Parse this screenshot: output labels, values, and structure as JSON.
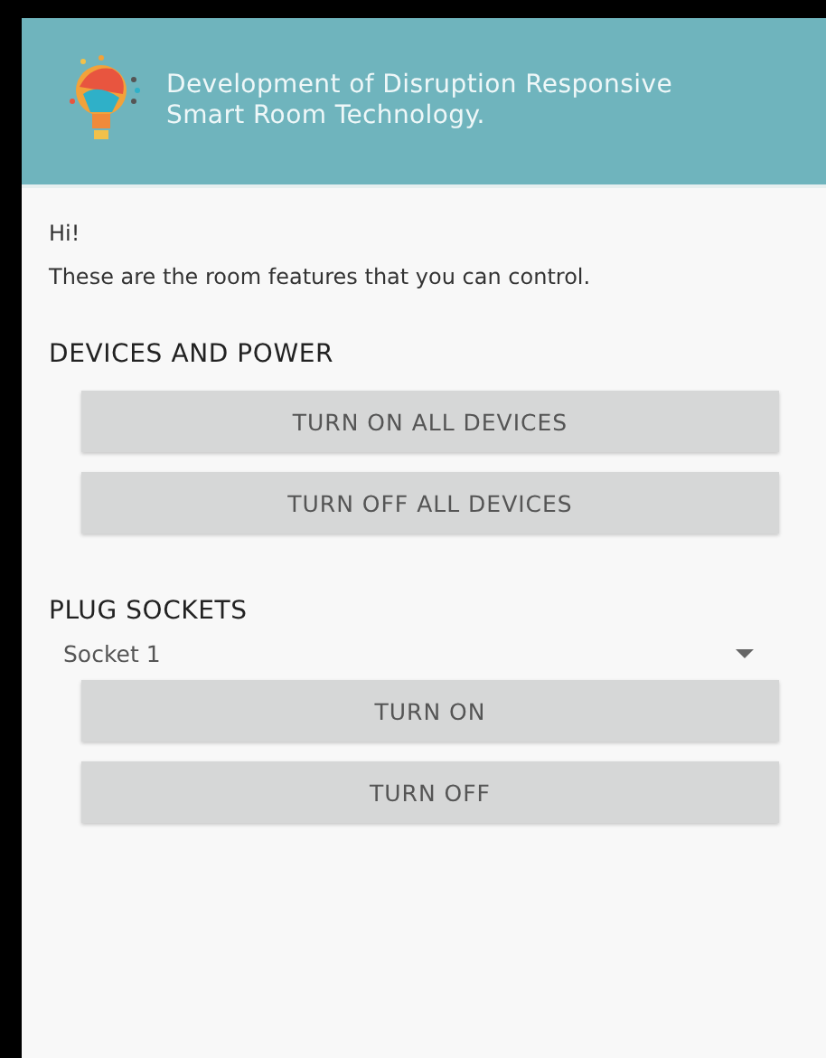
{
  "header": {
    "title_lines": [
      "Development of Disruption Responsive",
      "Smart Room Technology."
    ]
  },
  "greeting": "Hi!",
  "intro": "These are the room features that you can control.",
  "sections": [
    {
      "kind": "buttons",
      "heading": "DEVICES AND POWER",
      "buttons": [
        "TURN ON ALL DEVICES",
        "TURN OFF ALL DEVICES"
      ]
    },
    {
      "kind": "dropdown",
      "heading": "PLUG SOCKETS",
      "dropdown": {
        "value": "Socket 1"
      },
      "buttons": [
        "TURN ON",
        "TURN OFF"
      ]
    }
  ]
}
